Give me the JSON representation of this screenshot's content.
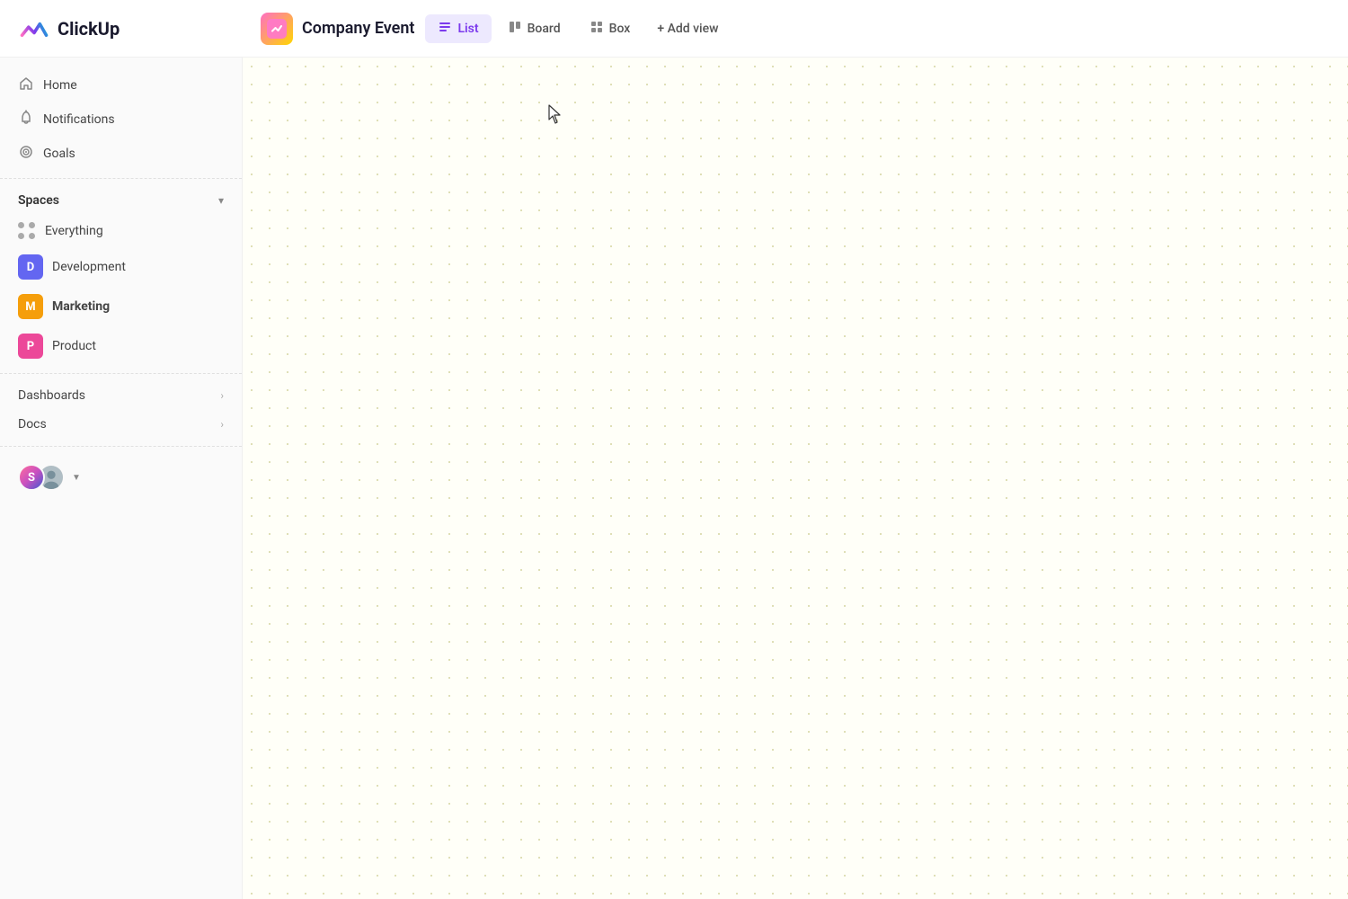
{
  "header": {
    "logo_text": "ClickUp",
    "project_title": "Company Event",
    "tabs": [
      {
        "id": "list",
        "label": "List",
        "icon": "≡",
        "active": true
      },
      {
        "id": "board",
        "label": "Board",
        "icon": "⊞",
        "active": false
      },
      {
        "id": "box",
        "label": "Box",
        "icon": "⊟",
        "active": false
      }
    ],
    "add_view_label": "+ Add view"
  },
  "sidebar": {
    "main_items": [
      {
        "id": "home",
        "label": "Home",
        "icon": "🏠"
      },
      {
        "id": "notifications",
        "label": "Notifications",
        "icon": "🔔"
      },
      {
        "id": "goals",
        "label": "Goals",
        "icon": "🏆"
      }
    ],
    "spaces_label": "Spaces",
    "spaces_items": [
      {
        "id": "everything",
        "label": "Everything",
        "type": "dots"
      },
      {
        "id": "development",
        "label": "Development",
        "type": "badge",
        "badge_color": "badge-blue",
        "badge_letter": "D"
      },
      {
        "id": "marketing",
        "label": "Marketing",
        "type": "badge",
        "badge_color": "badge-yellow",
        "badge_letter": "M",
        "bold": true
      },
      {
        "id": "product",
        "label": "Product",
        "type": "badge",
        "badge_color": "badge-pink",
        "badge_letter": "P"
      }
    ],
    "bottom_items": [
      {
        "id": "dashboards",
        "label": "Dashboards",
        "has_chevron": true
      },
      {
        "id": "docs",
        "label": "Docs",
        "has_chevron": true
      }
    ],
    "user": {
      "initials": "S",
      "chevron": "▼"
    }
  },
  "main": {
    "bg_dot_color": "#d4d4a0"
  }
}
